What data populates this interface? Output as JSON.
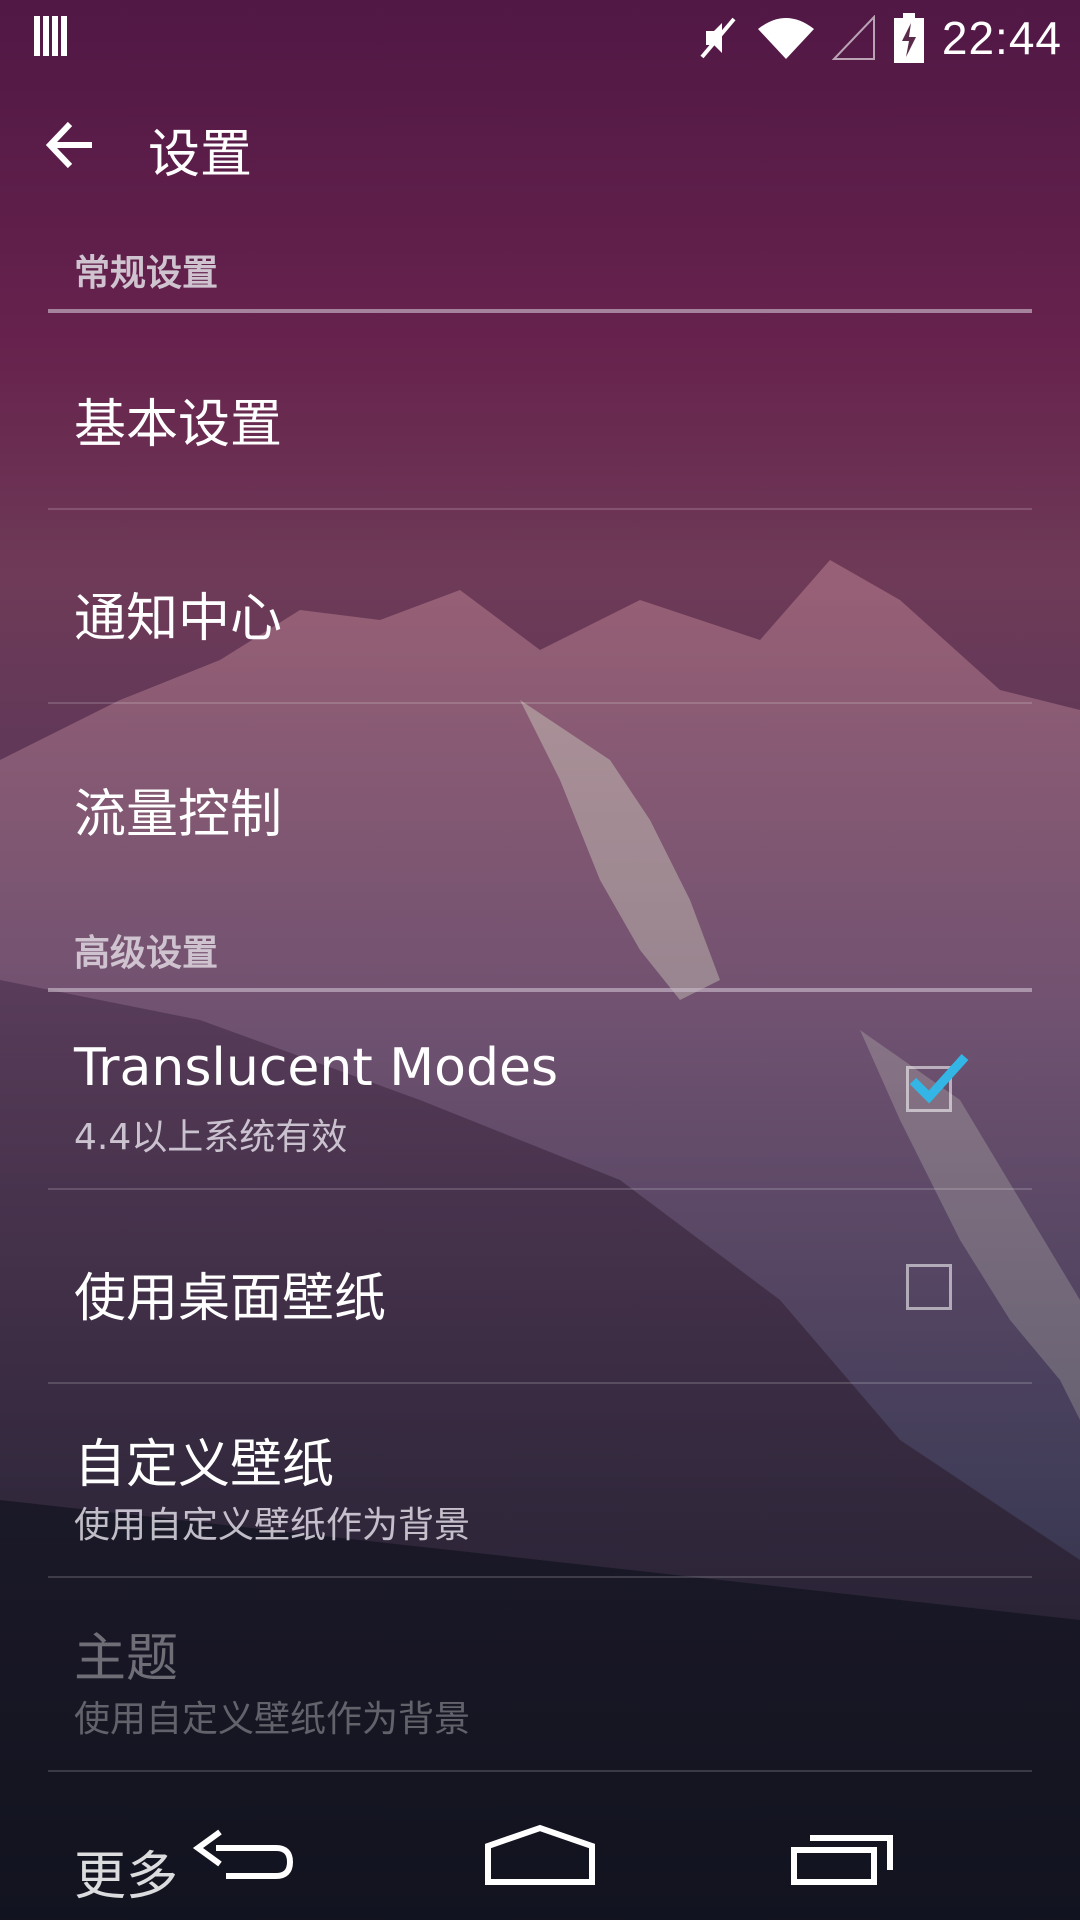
{
  "status_bar": {
    "time": "22:44",
    "icons": [
      "signal-bars-icon",
      "mute-icon",
      "wifi-icon",
      "cell-signal-icon",
      "battery-charging-icon"
    ]
  },
  "action_bar": {
    "back_icon": "back-arrow-icon",
    "title": "设置"
  },
  "sections": {
    "general": {
      "header": "常规设置",
      "items": [
        {
          "title": "基本设置"
        },
        {
          "title": "通知中心"
        },
        {
          "title": "流量控制"
        }
      ]
    },
    "advanced": {
      "header": "高级设置",
      "items": [
        {
          "title": "Translucent Modes",
          "summary": "4.4以上系统有效",
          "checked": true
        },
        {
          "title": "使用桌面壁纸",
          "checked": false
        },
        {
          "title": "自定义壁纸",
          "summary": "使用自定义壁纸作为背景"
        },
        {
          "title": "主题",
          "summary": "使用自定义壁纸作为背景",
          "enabled": false
        },
        {
          "title": "更多"
        }
      ]
    }
  },
  "nav_bar": {
    "back_icon": "nav-back-icon",
    "home_icon": "nav-home-icon",
    "recents_icon": "nav-recents-icon"
  },
  "colors": {
    "accent": "#33b5e5",
    "header_text": "#cfc3cf"
  }
}
